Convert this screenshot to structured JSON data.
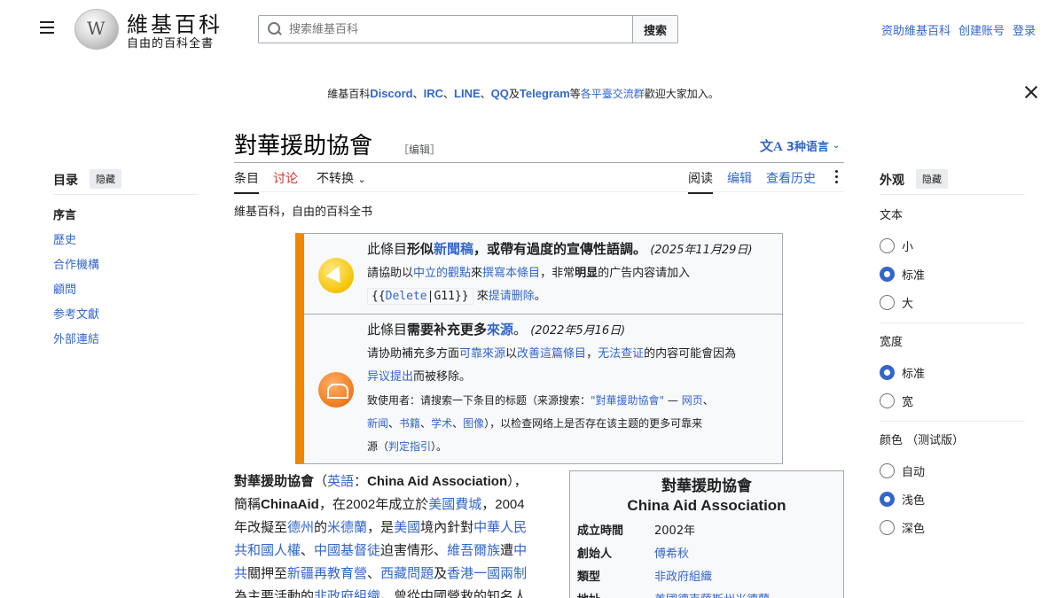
{
  "header": {
    "logo_title": "維基百科",
    "logo_subtitle": "自由的百科全書",
    "search_placeholder": "搜索維基百科",
    "search_button": "搜索",
    "links": [
      "资助維基百科",
      "创建账号",
      "登录"
    ]
  },
  "banner": {
    "prefix": "維基百科",
    "discord": "Discord",
    "sep1": "、",
    "irc": "IRC",
    "sep2": "、",
    "line": "LINE",
    "sep3": "、",
    "qq": "QQ",
    "and": "及",
    "telegram": "Telegram",
    "mid": "等",
    "platforms": "各平臺交流群",
    "suffix": "歡迎大家加入。"
  },
  "article": {
    "title": "對華援助協會",
    "edit_link": "［编辑］",
    "languages": "3种语言",
    "tabs": {
      "article": "条目",
      "talk": "讨论",
      "variant": "不转换",
      "read": "阅读",
      "edit": "编辑",
      "history": "查看历史"
    },
    "tagline": "維基百科，自由的百科全书"
  },
  "toc": {
    "heading": "目录",
    "hide": "隐藏",
    "items": [
      "序言",
      "歷史",
      "合作機構",
      "顧問",
      "参考文獻",
      "外部連結"
    ]
  },
  "appearance": {
    "heading": "外观",
    "hide": "隐藏",
    "text_label": "文本",
    "text_options": [
      "小",
      "标准",
      "大"
    ],
    "text_selected": "标准",
    "width_label": "宽度",
    "width_options": [
      "标准",
      "宽"
    ],
    "width_selected": "标准",
    "color_label": "颜色 （测试版）",
    "color_options": [
      "自动",
      "浅色",
      "深色"
    ],
    "color_selected": "浅色"
  },
  "ambox1": {
    "a": "此條目",
    "b": "形似",
    "c": "新聞稿",
    "d": "，或帶有過度的宣傳性語調。",
    "date": "(2025年11月29日)",
    "l2a": "請協助以",
    "l2b": "中立的觀點",
    "l2c": "來",
    "l2d": "撰寫本條目",
    "l2e": "，非常",
    "l2f": "明显",
    "l2g": "的广告内容请加入",
    "tpl_open": "{{",
    "tpl_delete": "Delete",
    "tpl_sep": "|G11}}",
    "l3a": "來",
    "l3b": "提请删除",
    "l3c": "。"
  },
  "ambox2": {
    "a": "此條目",
    "b": "需要补充更多",
    "c": "來源",
    "d": "。",
    "date": "(2022年5月16日)",
    "l2a": "请协助補充多方面",
    "l2b": "可靠來源",
    "l2c": "以",
    "l2d": "改善這篇條目",
    "l2e": "，",
    "l2f": "无法查证",
    "l2g": "的内容可能會因為",
    "l3a": "异议提出",
    "l3b": "而被移除。",
    "l4a": "致使用者：请搜索一下条目的标题（来源搜索：",
    "l4b": "\"對華援助協會\"",
    "l4c": " — ",
    "l4d": "网页",
    "l4e": "、",
    "l5a": "新闻",
    "l5b": "、",
    "l5c": "书籍",
    "l5d": "、",
    "l5e": "学术",
    "l5f": "、",
    "l5g": "图像",
    "l5h": "），以检查网络上是否存在该主题的更多可靠来",
    "l6a": "源（",
    "l6b": "判定指引",
    "l6c": "）。"
  },
  "lead": {
    "name": "對華援助協會",
    "p1": "（",
    "lang": "英語",
    "p2": "：",
    "en": "China Aid Association",
    "p3": "），",
    "l2a": "簡稱",
    "short": "ChinaAid",
    "l2b": "，在2002年成立於",
    "l2c": "美國費城",
    "l2d": "，2004",
    "l3a": "年改擬至",
    "l3b": "德州",
    "l3c": "的",
    "l3d": "米德蘭",
    "l3e": "，是",
    "l3f": "美國",
    "l3g": "境內針對",
    "l3h": "中華人民",
    "l4a": "共和國人權",
    "l4b": "、",
    "l4c": "中國基督徒",
    "l4d": "迫害情形、",
    "l4e": "維吾爾族",
    "l4f": "遭",
    "l4g": "中",
    "l5a": "共",
    "l5b": "關押至",
    "l5c": "新疆再教育營",
    "l5d": "、",
    "l5e": "西藏問題",
    "l5f": "及",
    "l5g": "香港一國兩制",
    "l6a": "為主要活動的",
    "l6b": "非政府組織",
    "l6c": "。曾從中國營救的知名人"
  },
  "infobox": {
    "title_zh": "對華援助協會",
    "title_en": "China Aid Association",
    "rows": [
      {
        "k": "成立時間",
        "v": "2002年"
      },
      {
        "k": "創始人",
        "v": "傅希秋"
      },
      {
        "k": "類型",
        "v": "非政府組織"
      },
      {
        "k": "地址",
        "v": "美國德克薩斯州米德蘭"
      }
    ]
  }
}
